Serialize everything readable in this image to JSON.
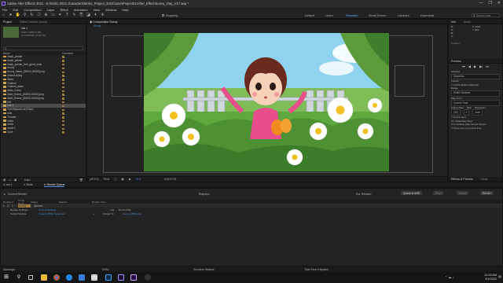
{
  "window": {
    "title": "Adobe After Effects 2021 - E:\\Moho 2021 characters\\Moho_Project_2022\\June\\Project01\\After_Effect\\Sunny_Day_V17.aep *",
    "controls": [
      "—",
      "❐",
      "✕"
    ]
  },
  "menu": [
    "File",
    "Edit",
    "Composition",
    "Layer",
    "Effect",
    "Animation",
    "View",
    "Window",
    "Help"
  ],
  "toolbar": {
    "snapping_label": "Snapping",
    "workspaces": [
      {
        "label": "Default",
        "active": false
      },
      {
        "label": "Learn",
        "active": false
      },
      {
        "label": "Standard",
        "active": true
      },
      {
        "label": "Small Screen",
        "active": false
      },
      {
        "label": "Libraries",
        "active": false
      },
      {
        "label": "Essentials",
        "active": false
      }
    ],
    "search_placeholder": "Search Help"
  },
  "project": {
    "tabs": [
      "Project",
      "Effect Controls (none)"
    ],
    "selected_name": "hair 1",
    "info_lines": [
      "1920 x 1080 (1.00)",
      "Δ 0;00;00;00, 29.97 fps"
    ],
    "search_placeholder": "",
    "columns": [
      "Name",
      "Comment"
    ],
    "items": [
      "black_pointer",
      "black_pointer",
      "black_pointer_free_grind_main",
      "bunny",
      "bunny_frame_[00000-00000].png",
      "Branch-flying",
      "Birds",
      "Custom",
      "Custom_plane",
      "Main_Comp",
      "Main_Scene_[00000-00000].png",
      "Main_Scene_[00000-00000].png",
      "left",
      "hair 1",
      "Full Ellipsoid cut (Fake)",
      "kids",
      "Theater",
      "video",
      "world",
      "world 1",
      "Zone"
    ],
    "selected_index": 13,
    "bpc": "8 bpc"
  },
  "composition": {
    "tab_label": "Composition Sunny",
    "sub_tab": "Sunny",
    "zoom": "(49.1%)",
    "resolution": "Third",
    "timecode": "0;00;07;03",
    "offset": "+0.0"
  },
  "right_panel": {
    "tabs": [
      "Info",
      "Audio"
    ],
    "info_values": [
      "R:",
      "G:",
      "B:",
      "A:",
      "X: 1024",
      "Y: 862"
    ],
    "position_label": "Position",
    "preview": {
      "title": "Preview",
      "shortcut_label": "Shortcut",
      "shortcut_value": "Spacebar",
      "include_label": "Include:",
      "cache_label": "Cache Before Playback",
      "range_label": "Range",
      "range_value": "Entire Duration",
      "play_from_label": "Play From",
      "play_from_value": "Current Time",
      "frame_rate_label": "Frame Rate",
      "skip_label": "Skip",
      "resolution_label": "Resolution",
      "frame_rate_value": "(30)",
      "skip_value": "0",
      "resolution_value": "Auto",
      "fullscreen_label": "Full Screen",
      "on_stop_label": "On (Spacebar) Stop:",
      "if_caching_label": "If caching, play cached frames",
      "move_time_label": "Move time to preview time"
    },
    "effects_tabs": [
      "Effects & Presets",
      "Librar"
    ]
  },
  "bottom_tabs": [
    {
      "label": "tab 1",
      "active": false
    },
    {
      "label": "Birds",
      "active": false
    },
    {
      "label": "Render Queue",
      "active": true
    }
  ],
  "render_queue": {
    "current_render_label": "Current Render",
    "elapsed_label": "Elapsed:",
    "est_remain_label": "Est. Remain:",
    "queue_ame_label": "Queue in AME",
    "stop_label": "Stop",
    "pause_label": "Pause",
    "render_label": "Render",
    "columns": [
      "Render",
      "#",
      "Comp Name",
      "Status",
      "Started",
      "Render Time"
    ],
    "item": {
      "number": "1",
      "comp": "Sunny",
      "status": "Queued"
    },
    "render_settings_label": "Render Settings:",
    "render_settings_value": "Current Settings",
    "output_module_label": "Output Module:",
    "output_module_value": "Custom: PNG Sequence",
    "log_label": "Log:",
    "log_value": "Errors Only",
    "output_to_label": "Output To:",
    "output_to_value": "Sunny_[###].png"
  },
  "status_bar": {
    "message_label": "Message:",
    "ram_label": "RAM:",
    "renders_started_label": "Renders Started:",
    "total_time_label": "Total Time Elapsed:"
  },
  "taskbar": {
    "time": "12:26 AM",
    "date": "9/1/2022",
    "icons": [
      "windows-start",
      "search",
      "task-view",
      "file-explorer",
      "chrome",
      "edge",
      "store",
      "mail",
      "photoshop",
      "after-effects",
      "media-encoder",
      "obs"
    ]
  }
}
